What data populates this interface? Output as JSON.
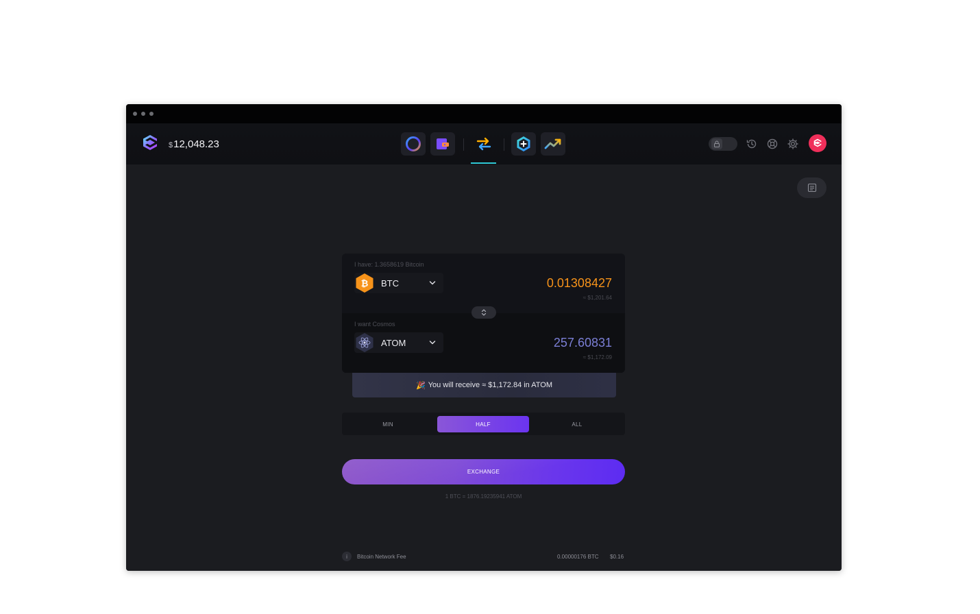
{
  "window": {
    "controls": [
      "close-dot",
      "minimize-dot",
      "maximize-dot"
    ]
  },
  "header": {
    "balance_currency": "$",
    "balance_value": "12,048.23",
    "nav": [
      {
        "name": "portfolio",
        "icon": "portfolio-ring-icon"
      },
      {
        "name": "wallet",
        "icon": "wallet-icon"
      },
      {
        "name": "exchange",
        "icon": "exchange-arrows-icon",
        "active": true
      },
      {
        "name": "apps",
        "icon": "apps-add-icon"
      },
      {
        "name": "markets",
        "icon": "trend-up-icon"
      }
    ],
    "right_icons": [
      "lock-toggle",
      "history-icon",
      "help-icon",
      "settings-icon",
      "avatar"
    ]
  },
  "exchange": {
    "from_hint": "I have: 1.3658619 Bitcoin",
    "from_coin": "BTC",
    "from_amount": "0.01308427",
    "from_usd": "≈ $1,201.64",
    "to_hint": "I want Cosmos",
    "to_coin": "ATOM",
    "to_amount": "257.60831",
    "to_usd": "≈ $1,172.09",
    "receive_text": "You will receive ≈ $1,172.84 in ATOM",
    "receive_emoji": "🎉",
    "amount_options": [
      "MIN",
      "HALF",
      "ALL"
    ],
    "selected_option": "HALF",
    "exchange_label": "EXCHANGE",
    "rate_text": "1 BTC = 1876.19235941 ATOM",
    "fee_label": "Bitcoin Network Fee",
    "fee_btc": "0.00000176 BTC",
    "fee_usd": "$0.16",
    "info_icon_text": "i"
  },
  "colors": {
    "btc_orange": "#f7931a",
    "atom_purple": "#7b7fd6",
    "accent_gradient_start": "#8a52c8",
    "accent_gradient_end": "#5d2cf2",
    "active_tab_underline": "#2fc9d6",
    "avatar_red": "#ef2f5a"
  }
}
